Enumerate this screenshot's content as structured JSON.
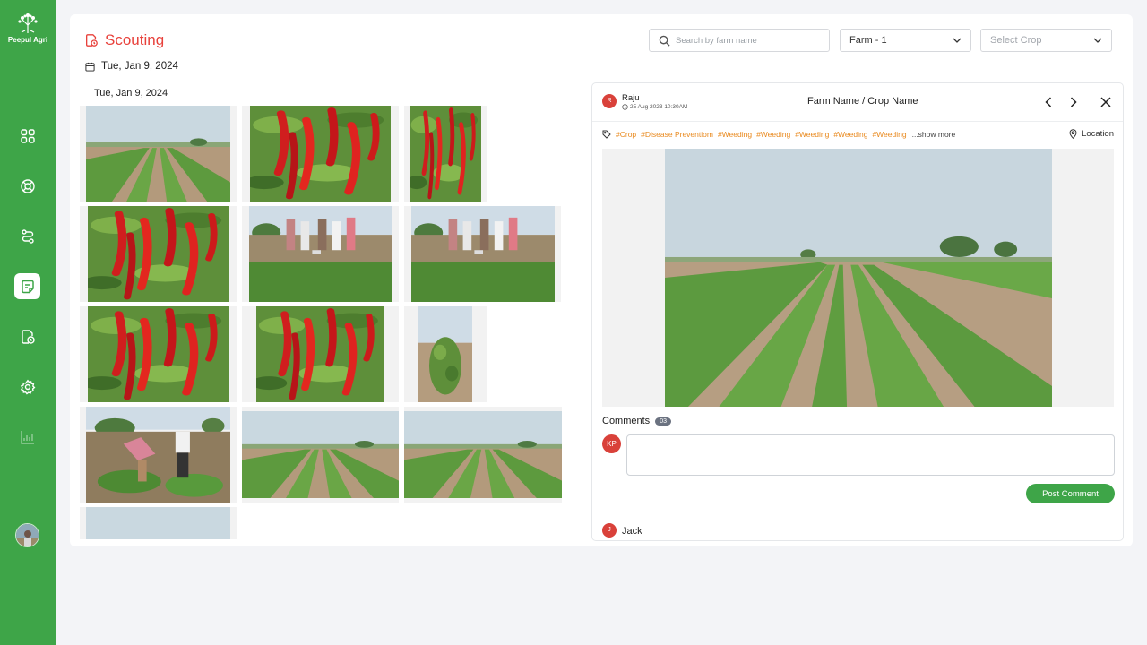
{
  "brand": {
    "name": "Peepul Agri"
  },
  "sidebar": {
    "items": [
      {
        "icon": "dashboard-grid-icon"
      },
      {
        "icon": "lifebuoy-icon"
      },
      {
        "icon": "route-icon"
      },
      {
        "icon": "notes-icon",
        "active": true
      },
      {
        "icon": "scouting-icon"
      },
      {
        "icon": "settings-gear-icon"
      },
      {
        "icon": "analytics-chart-icon",
        "disabled": true
      }
    ]
  },
  "header": {
    "title": "Scouting",
    "date": "Tue, Jan 9, 2024",
    "search_placeholder": "Search by farm name",
    "farm_select": "Farm - 1",
    "crop_select": "Select Crop"
  },
  "gallery": {
    "date_heading": "Tue, Jan 9, 2024",
    "photos": [
      "field-rows",
      "red-chilli-plant",
      "red-chilli-closeup",
      "red-chilli-plant",
      "group-in-field",
      "group-in-field",
      "red-chilli-plant",
      "red-chilli-closeup",
      "single-plant",
      "farmers-inspecting",
      "field-rows",
      "field-rows",
      "field-rows"
    ]
  },
  "detail": {
    "user_initial": "R",
    "user": "Raju",
    "timestamp": "25 Aug 2023 10:30AM",
    "title": "Farm Name / Crop Name",
    "tags": [
      "#Crop",
      "#Disease Preventiom",
      "#Weeding",
      "#Weeding",
      "#Weeding",
      "#Weeding",
      "#Weeding"
    ],
    "show_more": "...show more",
    "location": "Location",
    "comments_label": "Comments",
    "comments_count": "03",
    "commenter_initials": "KP",
    "post_button": "Post Comment",
    "next_comment_initial": "J",
    "next_comment_user": "Jack"
  },
  "colors": {
    "brand_green": "#3ea548",
    "accent_red": "#e8413b",
    "tag_orange": "#e98a1f"
  }
}
